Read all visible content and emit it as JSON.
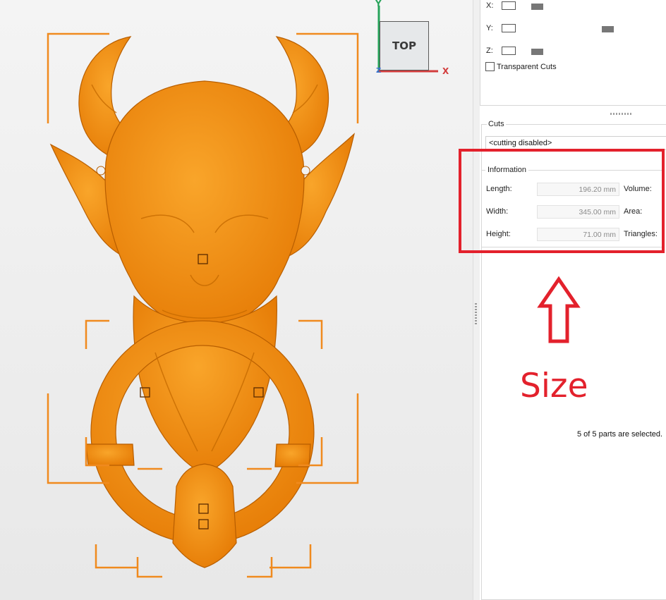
{
  "viewport": {
    "nav_cube_label": "TOP",
    "axes": {
      "y": "Y",
      "x": "X",
      "z": "Z"
    }
  },
  "clipping": {
    "x_label": "X:",
    "y_label": "Y:",
    "z_label": "Z:",
    "transparent_cuts_label": "Transparent Cuts",
    "transparent_cuts_checked": false
  },
  "cuts": {
    "title": "Cuts",
    "value": "<cutting disabled>"
  },
  "information": {
    "title": "Information",
    "rows": [
      {
        "name": "Length:",
        "value": "196.20 mm",
        "extra": "Volume:"
      },
      {
        "name": "Width:",
        "value": "345.00 mm",
        "extra": "Area:"
      },
      {
        "name": "Height:",
        "value": "71.00 mm",
        "extra": "Triangles:"
      }
    ]
  },
  "annotation": {
    "label": "Size",
    "color": "#e3212c"
  },
  "status": "5 of 5 parts are selected.",
  "colors": {
    "model": "#f28c0f",
    "selection_bracket": "#f08a1e"
  }
}
